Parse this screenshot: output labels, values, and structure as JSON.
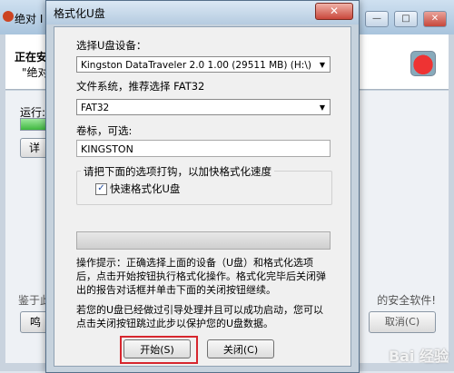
{
  "background_window": {
    "title": "绝对 I",
    "heading": "正在安",
    "sub": "\"绝对",
    "run_label": "运行:",
    "detail_button": "详",
    "left_text": "鉴于此",
    "right_text": "的安全软件!",
    "left_button": "鸣",
    "cancel_button": "取消(C)",
    "window_controls": [
      "—",
      "□",
      "✕"
    ]
  },
  "dialog": {
    "title": "格式化U盘",
    "close_label": "✕",
    "device_label": "选择U盘设备：",
    "device_value": "Kingston DataTraveler 2.0 1.00 (29511 MB) (H:\\)",
    "fs_label": "文件系统，推荐选择 FAT32",
    "fs_value": "FAT32",
    "volume_label": "卷标，可选:",
    "volume_value": "KINGSTON",
    "group_legend": "请把下面的选项打钩，以加快格式化速度",
    "quick_format_label": "快速格式化U盘",
    "quick_format_checked": true,
    "tip": "操作提示：正确选择上面的设备（U盘）和格式化选项后，点击开始按钮执行格式化操作。格式化完毕后关闭弹出的报告对话框并单击下面的关闭按钮继续。",
    "note": "若您的U盘已经做过引导处理并且可以成功启动，您可以点击关闭按钮跳过此步以保护您的U盘数据。",
    "start_button": "开始(S)",
    "close_button": "关闭(C)"
  },
  "watermark": "Bai 经验",
  "colors": {
    "highlight": "#d7262e",
    "dialog_frame": "#c6d2dd"
  }
}
